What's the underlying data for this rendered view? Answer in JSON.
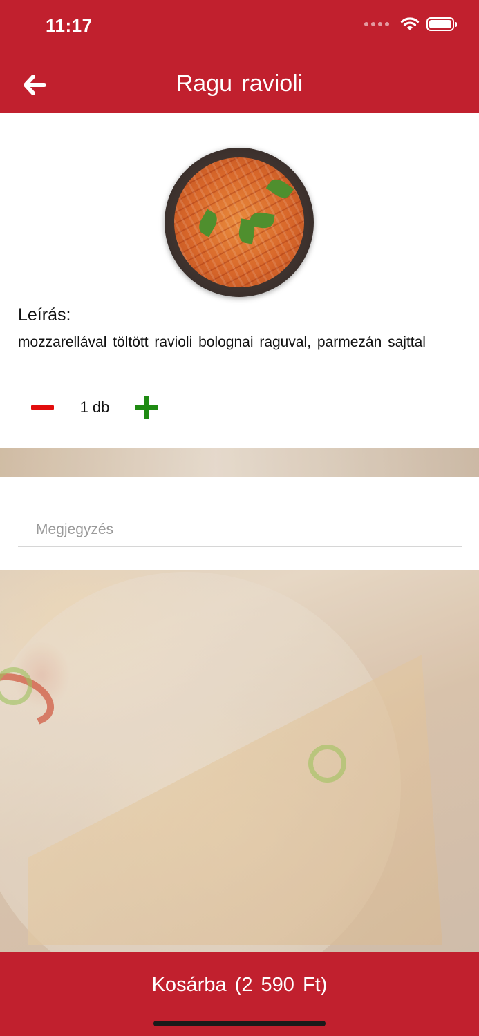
{
  "status_bar": {
    "time": "11:17"
  },
  "header": {
    "title": "Ragu ravioli",
    "back_icon": "arrow-left-icon"
  },
  "dish": {
    "image": "pasta-dish-image",
    "description_label": "Leírás:",
    "description": "mozzarellával töltött ravioli bolognai raguval, parmezán sajttal"
  },
  "quantity": {
    "value": "1 db",
    "minus_color": "#e20d0d",
    "plus_color": "#1e8a12"
  },
  "note": {
    "placeholder": "Megjegyzés",
    "value": ""
  },
  "footer": {
    "cart_label": "Kosárba (2 590 Ft)"
  },
  "colors": {
    "brand": "#c1202e",
    "surface": "#ffffff"
  }
}
